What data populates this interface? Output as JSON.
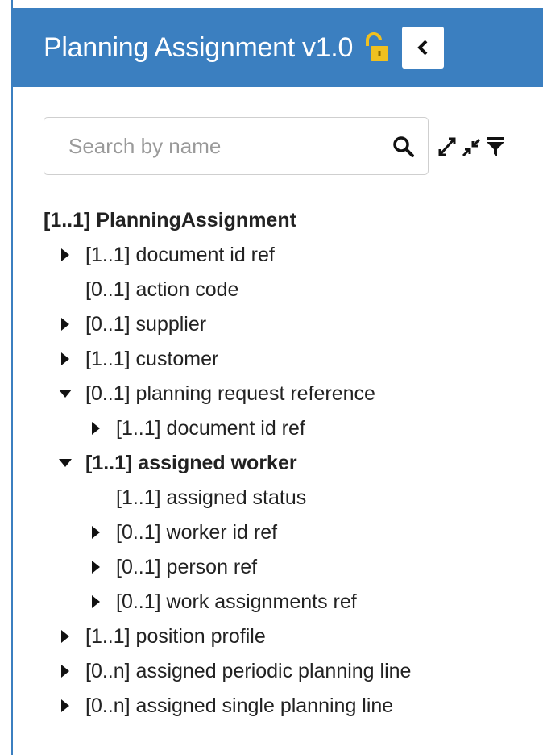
{
  "header": {
    "title": "Planning Assignment v1.0",
    "lock_icon": "unlocked-padlock-icon",
    "collapse_icon": "chevron-left-icon",
    "accent_color": "#3b7fc0"
  },
  "search": {
    "placeholder": "Search by name",
    "value": "",
    "icon": "search-icon"
  },
  "toolbar": {
    "expand_all_icon": "expand-all-icon",
    "collapse_all_icon": "collapse-all-icon",
    "filter_icon": "filter-icon"
  },
  "tree": {
    "root": "[1..1] PlanningAssignment",
    "nodes": [
      {
        "label": "[1..1] document id ref",
        "depth": 0,
        "toggle": "collapsed"
      },
      {
        "label": "[0..1] action code",
        "depth": 0,
        "toggle": "none"
      },
      {
        "label": "[0..1] supplier",
        "depth": 0,
        "toggle": "collapsed"
      },
      {
        "label": "[1..1] customer",
        "depth": 0,
        "toggle": "collapsed"
      },
      {
        "label": "[0..1] planning request reference",
        "depth": 0,
        "toggle": "expanded"
      },
      {
        "label": "[1..1] document id ref",
        "depth": 1,
        "toggle": "collapsed"
      },
      {
        "label": "[1..1] assigned worker",
        "depth": 0,
        "toggle": "expanded",
        "bold": true
      },
      {
        "label": "[1..1] assigned status",
        "depth": 1,
        "toggle": "none"
      },
      {
        "label": "[0..1] worker id ref",
        "depth": 1,
        "toggle": "collapsed"
      },
      {
        "label": "[0..1] person ref",
        "depth": 1,
        "toggle": "collapsed"
      },
      {
        "label": "[0..1] work assignments ref",
        "depth": 1,
        "toggle": "collapsed"
      },
      {
        "label": "[1..1] position profile",
        "depth": 0,
        "toggle": "collapsed"
      },
      {
        "label": "[0..n] assigned periodic planning line",
        "depth": 0,
        "toggle": "collapsed"
      },
      {
        "label": "[0..n] assigned single planning line",
        "depth": 0,
        "toggle": "collapsed"
      }
    ]
  }
}
